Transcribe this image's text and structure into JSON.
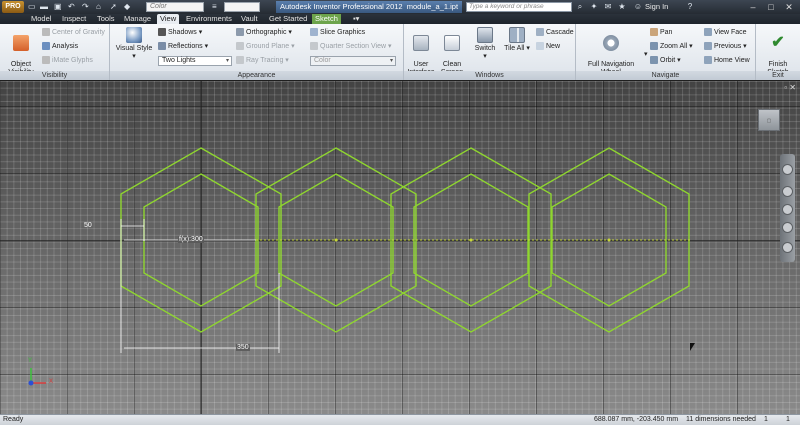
{
  "titlebar": {
    "app_logo": "PRO",
    "appearance_box": "Color",
    "title_app": "Autodesk Inventor Professional 2012",
    "title_file": "module_a_1.ipt",
    "search_placeholder": "Type a keyword or phrase",
    "signin": "Sign In"
  },
  "tabs": [
    {
      "label": "Model"
    },
    {
      "label": "Inspect"
    },
    {
      "label": "Tools"
    },
    {
      "label": "Manage"
    },
    {
      "label": "View",
      "active": true
    },
    {
      "label": "Environments"
    },
    {
      "label": "Vault"
    },
    {
      "label": "Get Started"
    },
    {
      "label": "Sketch",
      "contextual": true
    }
  ],
  "ribbon": {
    "visibility": {
      "title": "Visibility",
      "object_visibility": "Object\nVisibility",
      "center_of_gravity": "Center of Gravity",
      "analysis": "Analysis",
      "imate_glyphs": "iMate Glyphs"
    },
    "appearance": {
      "title": "Appearance",
      "visual_style": "Visual Style",
      "shadows": "Shadows",
      "reflections": "Reflections",
      "lighting": "Two Lights",
      "orthographic": "Orthographic",
      "ground_plane": "Ground Plane",
      "ray_tracing": "Ray Tracing",
      "slice_graphics": "Slice Graphics",
      "quarter_section": "Quarter Section View",
      "color": "Color"
    },
    "windows": {
      "title": "Windows",
      "user_interface": "User\nInterface",
      "clean_screen": "Clean\nScreen",
      "switch": "Switch",
      "tile_all": "Tile All",
      "cascade": "Cascade",
      "new": "New"
    },
    "navigate": {
      "title": "Navigate",
      "full_nav_wheel": "Full Navigation\nWheel",
      "pan": "Pan",
      "zoom_all": "Zoom All",
      "orbit": "Orbit",
      "view_face": "View Face",
      "previous": "Previous",
      "home_view": "Home View"
    },
    "exit": {
      "title": "Exit",
      "finish_sketch": "Finish\nSketch"
    }
  },
  "sketch": {
    "dim_left": "50",
    "dim_mid": "f(x):300",
    "dim_bottom": "350",
    "axis_x": "X",
    "axis_y": "Y"
  },
  "status": {
    "ready": "Ready",
    "coords": "688.087 mm, -203.450 mm",
    "dims_needed": "11 dimensions needed",
    "count1": "1",
    "count2": "1"
  },
  "colors": {
    "sketch_green": "#8fd62f",
    "accent": "#3a6ea5"
  }
}
